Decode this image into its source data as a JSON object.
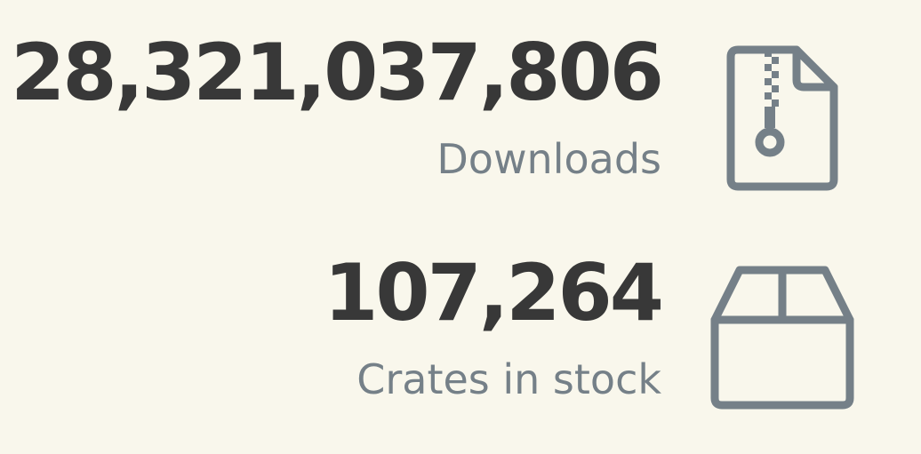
{
  "stats": {
    "downloads": {
      "value": "28,321,037,806",
      "label": "Downloads",
      "icon": "zip-file-icon"
    },
    "crates": {
      "value": "107,264",
      "label": "Crates in stock",
      "icon": "box-icon"
    }
  },
  "colors": {
    "background": "#f9f7ec",
    "value_text": "#383838",
    "label_text": "#758088",
    "icon_stroke": "#758088"
  }
}
